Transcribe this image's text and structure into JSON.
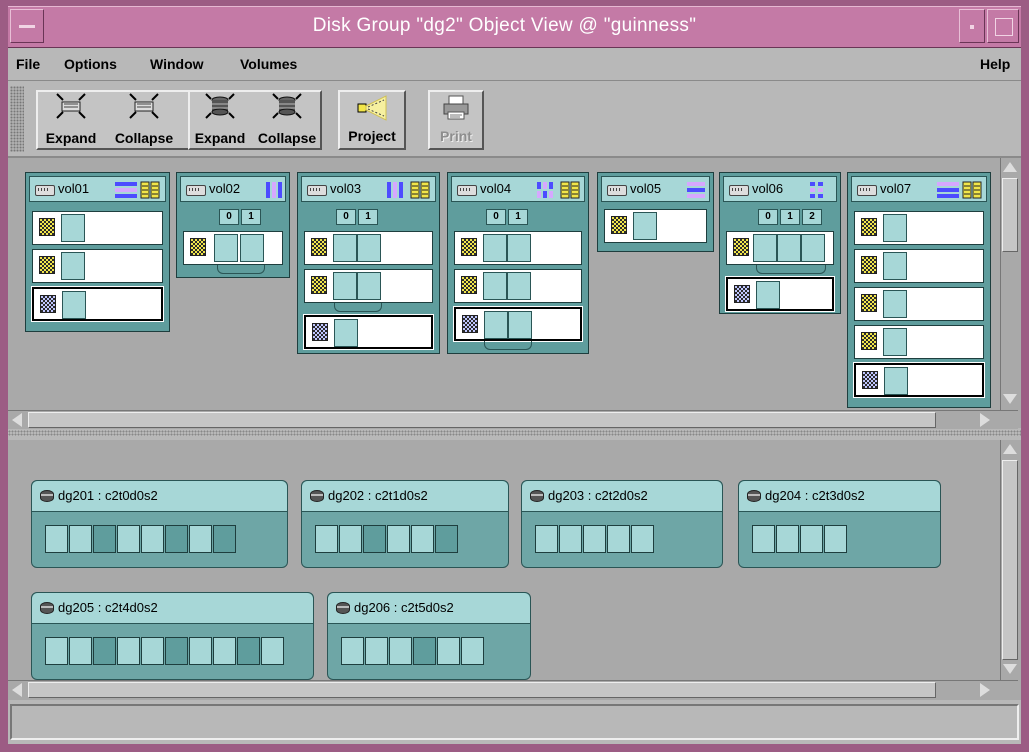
{
  "window": {
    "title": "Disk Group \"dg2\" Object View @ \"guinness\""
  },
  "menu": {
    "file": "File",
    "options": "Options",
    "window": "Window",
    "volumes": "Volumes",
    "help": "Help"
  },
  "toolbar": {
    "expand1": "Expand",
    "collapse1": "Collapse",
    "expand2": "Expand",
    "collapse2": "Collapse",
    "project": "Project",
    "print": "Print"
  },
  "volumes": [
    {
      "name": "vol01"
    },
    {
      "name": "vol02"
    },
    {
      "name": "vol03"
    },
    {
      "name": "vol04"
    },
    {
      "name": "vol05"
    },
    {
      "name": "vol06"
    },
    {
      "name": "vol07"
    }
  ],
  "columns": {
    "c0": "0",
    "c1": "1",
    "c2": "2"
  },
  "disks": [
    {
      "name": "dg201 : c2t0d0s2"
    },
    {
      "name": "dg202 : c2t1d0s2"
    },
    {
      "name": "dg203 : c2t2d0s2"
    },
    {
      "name": "dg204 : c2t3d0s2"
    },
    {
      "name": "dg205 : c2t4d0s2"
    },
    {
      "name": "dg206 : c2t5d0s2"
    }
  ]
}
